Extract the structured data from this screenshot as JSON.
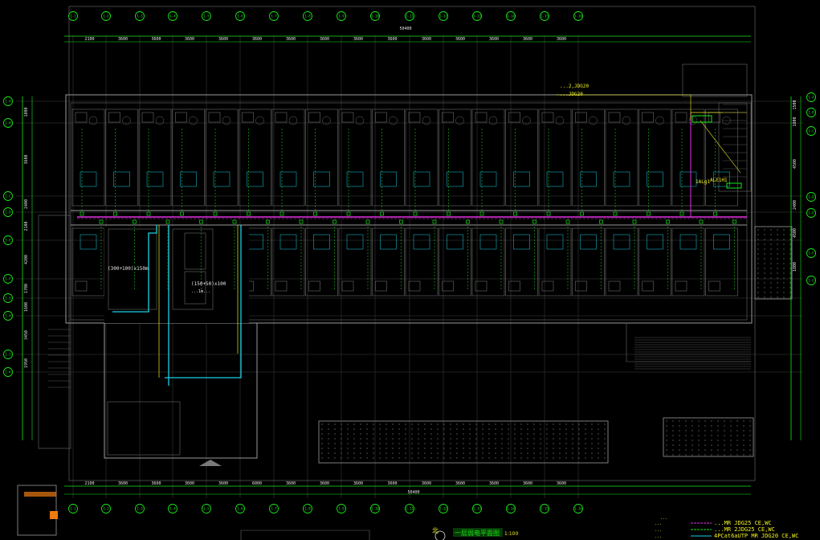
{
  "drawing": {
    "overall_dimension": "50400",
    "top_dims": [
      "2100",
      "3600",
      "3600",
      "3600",
      "3600",
      "3600",
      "3600",
      "3600",
      "3600",
      "3600",
      "3600",
      "3600",
      "3600",
      "3600",
      "3600"
    ],
    "bottom_dims": [
      "2100",
      "3600",
      "3600",
      "3600",
      "3600",
      "6000",
      "3600",
      "3600",
      "3600",
      "3600",
      "3600",
      "3600",
      "3600",
      "3600",
      "3600"
    ],
    "left_dims": [
      "1800",
      "3600",
      "2400",
      "2100",
      "4200",
      "1700",
      "1600",
      "3450",
      "1950",
      "3800",
      "4200"
    ],
    "right_dims": [
      "1500",
      "1800",
      "4500",
      "2400",
      "4500",
      "1800",
      "1200",
      "4200",
      "3000"
    ],
    "x_axes": [
      "1-1",
      "1-2",
      "1-3",
      "1-4",
      "1-5",
      "1-6",
      "1-7",
      "1-8",
      "1-9",
      "1-10",
      "1-11",
      "1-12",
      "1-13",
      "1-14",
      "1-15",
      "1-16"
    ],
    "y_axes_left": [
      "1-A",
      "1-B",
      "1-C",
      "1-D",
      "1-E",
      "1-F",
      "1-G",
      "1-H",
      "1-J",
      "1-K"
    ],
    "y_axes_right": [
      "1-A",
      "1-B",
      "1-C",
      "1-D",
      "1-E",
      "1-F",
      "1-G"
    ],
    "annotations": {
      "top_note": "...2,JDG20",
      "top_note2": "...JDG20",
      "panel_label": "1ALg1",
      "panel_label2": "ALE1H1",
      "tray_1": "(300+100)x150m",
      "tray_2": "(150+50)x100",
      "tray_note": "...1m..."
    },
    "legend": {
      "title": "...",
      "rows": [
        {
          "label": "...",
          "spec": "...MR JDG25 CE,WC"
        },
        {
          "label": "...",
          "spec": "...MR 2JDG25 CE,WC"
        },
        {
          "label": "...",
          "spec": "4PCat6aUTP MR JDG20 CE,WC"
        }
      ]
    },
    "plan_title": "一层弱电平面图",
    "plan_scale": "1:100",
    "north": "北",
    "colors": {
      "background": "#000000",
      "wall": "#9a9a9a",
      "axis": "#19e619",
      "cable_magenta": "#e030e0",
      "cable_cyan": "#19d0e6",
      "text_yellow": "#f0f020",
      "dim_white": "#e6e6e6",
      "orange": "#f07a10"
    }
  }
}
